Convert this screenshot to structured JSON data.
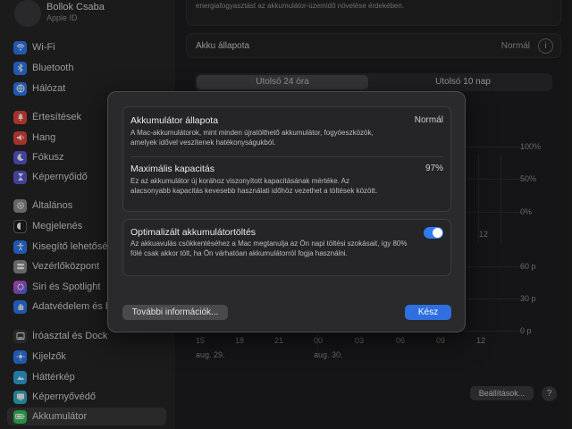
{
  "account": {
    "name": "Bollok Csaba",
    "subtitle": "Apple ID"
  },
  "sidebar": {
    "items": [
      {
        "label": "Wi-Fi",
        "icon": "wifi-icon",
        "color": "#2f7bf3"
      },
      {
        "label": "Bluetooth",
        "icon": "bluetooth-icon",
        "color": "#2f7bf3"
      },
      {
        "label": "Hálózat",
        "icon": "globe-icon",
        "color": "#2f7bf3"
      },
      {
        "label": "Értesítések",
        "icon": "bell-icon",
        "color": "#e5453f"
      },
      {
        "label": "Hang",
        "icon": "speaker-icon",
        "color": "#e5453f"
      },
      {
        "label": "Fókusz",
        "icon": "moon-icon",
        "color": "#5b5bd6"
      },
      {
        "label": "Képernyőidő",
        "icon": "hourglass-icon",
        "color": "#5b5bd6"
      },
      {
        "label": "Általános",
        "icon": "gear-icon",
        "color": "#8e8e93"
      },
      {
        "label": "Megjelenés",
        "icon": "appearance-icon",
        "color": "#1c1c1e"
      },
      {
        "label": "Kisegítő lehetőségek",
        "icon": "accessibility-icon",
        "color": "#2f7bf3"
      },
      {
        "label": "Vezérlőközpont",
        "icon": "control-center-icon",
        "color": "#8e8e93"
      },
      {
        "label": "Siri és Spotlight",
        "icon": "siri-icon",
        "color": "#a94fd8"
      },
      {
        "label": "Adatvédelem és biztonság",
        "icon": "hand-icon",
        "color": "#2f7bf3"
      },
      {
        "label": "Íróasztal és Dock",
        "icon": "dock-icon",
        "color": "#3a3a3c"
      },
      {
        "label": "Kijelzők",
        "icon": "display-icon",
        "color": "#2f7bf3"
      },
      {
        "label": "Háttérkép",
        "icon": "wallpaper-icon",
        "color": "#2fa8e0"
      },
      {
        "label": "Képernyővédő",
        "icon": "screensaver-icon",
        "color": "#2fb0c8"
      },
      {
        "label": "Akkumulátor",
        "icon": "battery-icon",
        "color": "#34c759"
      }
    ]
  },
  "main": {
    "top_text": "energiafogyasztást az akkumulátor-üzemidő növelése érdekében.",
    "health_label": "Akku állapota",
    "health_value": "Normál",
    "tabs": [
      "Utolsó 24 óra",
      "Utolsó 10 nap"
    ],
    "y_ticks_pct": [
      "100%",
      "50%",
      "0%"
    ],
    "y_ticks_min": [
      "60 p",
      "30 p",
      "0 p"
    ],
    "x_ticks": [
      "15",
      "18",
      "21",
      "00",
      "03",
      "06",
      "09",
      "12"
    ],
    "x_tick_top": "12",
    "dates": [
      "aug. 29.",
      "aug. 30."
    ],
    "settings_label": "Beállítások...",
    "help_label": "?"
  },
  "modal": {
    "health_title": "Akkumulátor állapota",
    "health_value": "Normál",
    "health_desc": "A Mac-akkumulátorok, mint minden újratölthető akkumulátor, fogyóeszközök, amelyek idővel veszítenek hatékonyságukból.",
    "capacity_title": "Maximális kapacitás",
    "capacity_value": "97%",
    "capacity_desc": "Ez az akkumulátor új korához viszonyított kapacitásának mértéke. Az alacsonyabb kapacitás kevesebb használati időhöz vezethet a töltések között.",
    "opt_title": "Optimalizált akkumulátortöltés",
    "opt_desc": "Az akkuavulás csökkentéséhez a Mac megtanulja az Ön napi töltési szokásait, így 80% fölé csak akkor tölt, ha Ön várhatóan akkumulátorról fogja használni.",
    "opt_enabled": true,
    "more_label": "További információk...",
    "done_label": "Kész"
  }
}
